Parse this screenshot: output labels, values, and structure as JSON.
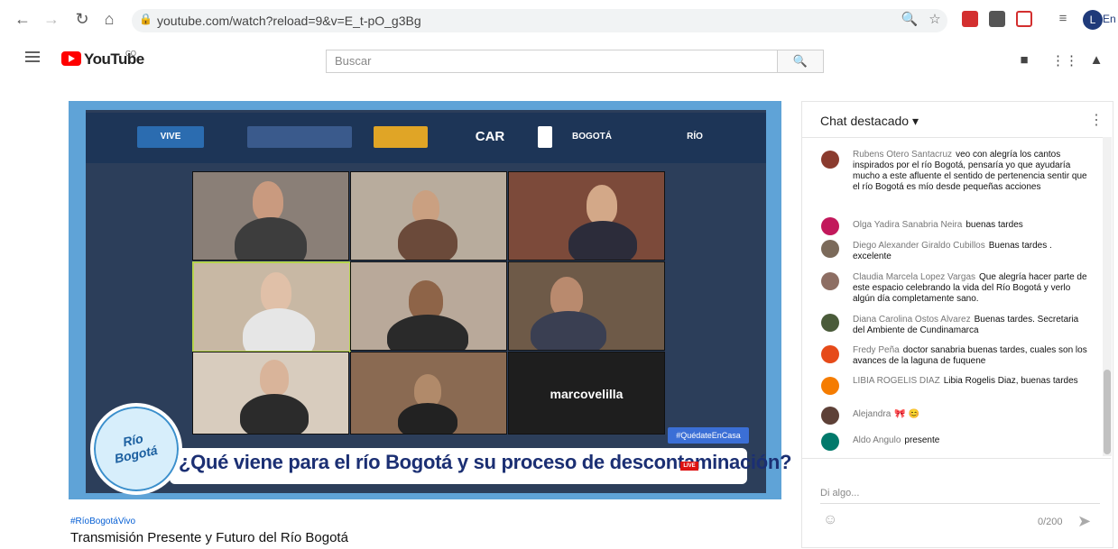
{
  "browser": {
    "url": "youtube.com/watch?reload=9&v=E_t-pO_g3Bg",
    "profile_initial": "L",
    "language_snippet": "En"
  },
  "youtube": {
    "logo_text": "YouTube",
    "country_code": "CO",
    "search_placeholder": "Buscar"
  },
  "video": {
    "logo_strip": [
      "VIVE",
      "CAR",
      "BOGOTÁ",
      "RÍO"
    ],
    "participants": [
      "",
      "",
      "",
      "",
      "",
      "",
      "",
      "",
      "marcovelilla"
    ],
    "banner_title": "¿Qué viene para el río Bogotá y su proceso de descontaminación?",
    "live_badge": "LIVE",
    "hashtag_badge": "#QuédateEnCasa",
    "logo_text": "Río Bogotá"
  },
  "meta": {
    "hashtag": "#RíoBogotáVivo",
    "title": "Transmisión Presente y Futuro del Río Bogotá"
  },
  "chat": {
    "header": "Chat destacado",
    "input_placeholder": "Di algo...",
    "char_count": "0/200",
    "messages": [
      {
        "author": "Rubens Otero Santacruz",
        "text": "veo con alegría los cantos inspirados por el río Bogotá, pensaría yo que ayudaría mucho a este afluente el sentido de pertenencia sentir que el río Bogotá es mío desde pequeñas acciones",
        "color": "#8a3b2e"
      },
      {
        "author": "Olga Yadira Sanabria Neira",
        "text": "buenas tardes",
        "color": "#c2185b"
      },
      {
        "author": "Diego Alexander Giraldo Cubillos",
        "text": "Buenas tardes . excelente",
        "color": "#7b6a5a"
      },
      {
        "author": "Claudia Marcela Lopez Vargas",
        "text": "Que alegría hacer parte de este espacio celebrando la vida del Río Bogotá y verlo algún día completamente sano.",
        "color": "#8d6e63"
      },
      {
        "author": "Diana Carolina Ostos Alvarez",
        "text": "Buenas tardes. Secretaria del Ambiente de Cundinamarca",
        "color": "#4a5b3a"
      },
      {
        "author": "Fredy Peña",
        "text": "doctor sanabria buenas tardes, cuales son los avances de la laguna de fuquene",
        "color": "#e64a19"
      },
      {
        "author": "LIBIA ROGELIS DIAZ",
        "text": "Libia Rogelis Diaz, buenas tardes",
        "color": "#f57c00"
      },
      {
        "author": "Alejandra",
        "text": "🎀 😊",
        "color": "#5d4037"
      },
      {
        "author": "Aldo Angulo",
        "text": "presente",
        "color": "#00796b"
      }
    ]
  }
}
